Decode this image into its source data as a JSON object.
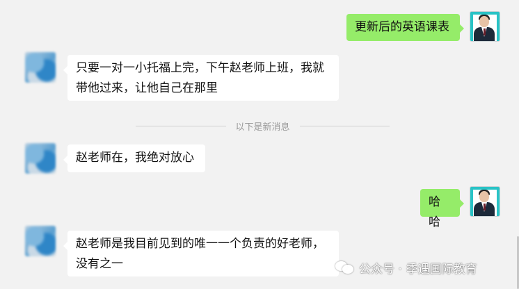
{
  "divider_text": "以下是新消息",
  "messages": [
    {
      "side": "out",
      "text": "更新后的英语课表"
    },
    {
      "side": "in",
      "line1": "只要一对一小托福上完，下午赵老师上班，我就",
      "line2": "带他过来，让他自己在那里"
    },
    {
      "side": "in",
      "text": "赵老师在，我绝对放心"
    },
    {
      "side": "out",
      "text": "哈哈"
    },
    {
      "side": "in",
      "line1": "赵老师是我目前见到的唯一一个负责的好老师，",
      "line2": "没有之一"
    }
  ],
  "watermark": {
    "separator": "公众号 ·",
    "account": "季遇国际教育"
  },
  "colors": {
    "background": "#f2f2f2",
    "out_bubble": "#95ec69",
    "in_bubble": "#ffffff"
  }
}
